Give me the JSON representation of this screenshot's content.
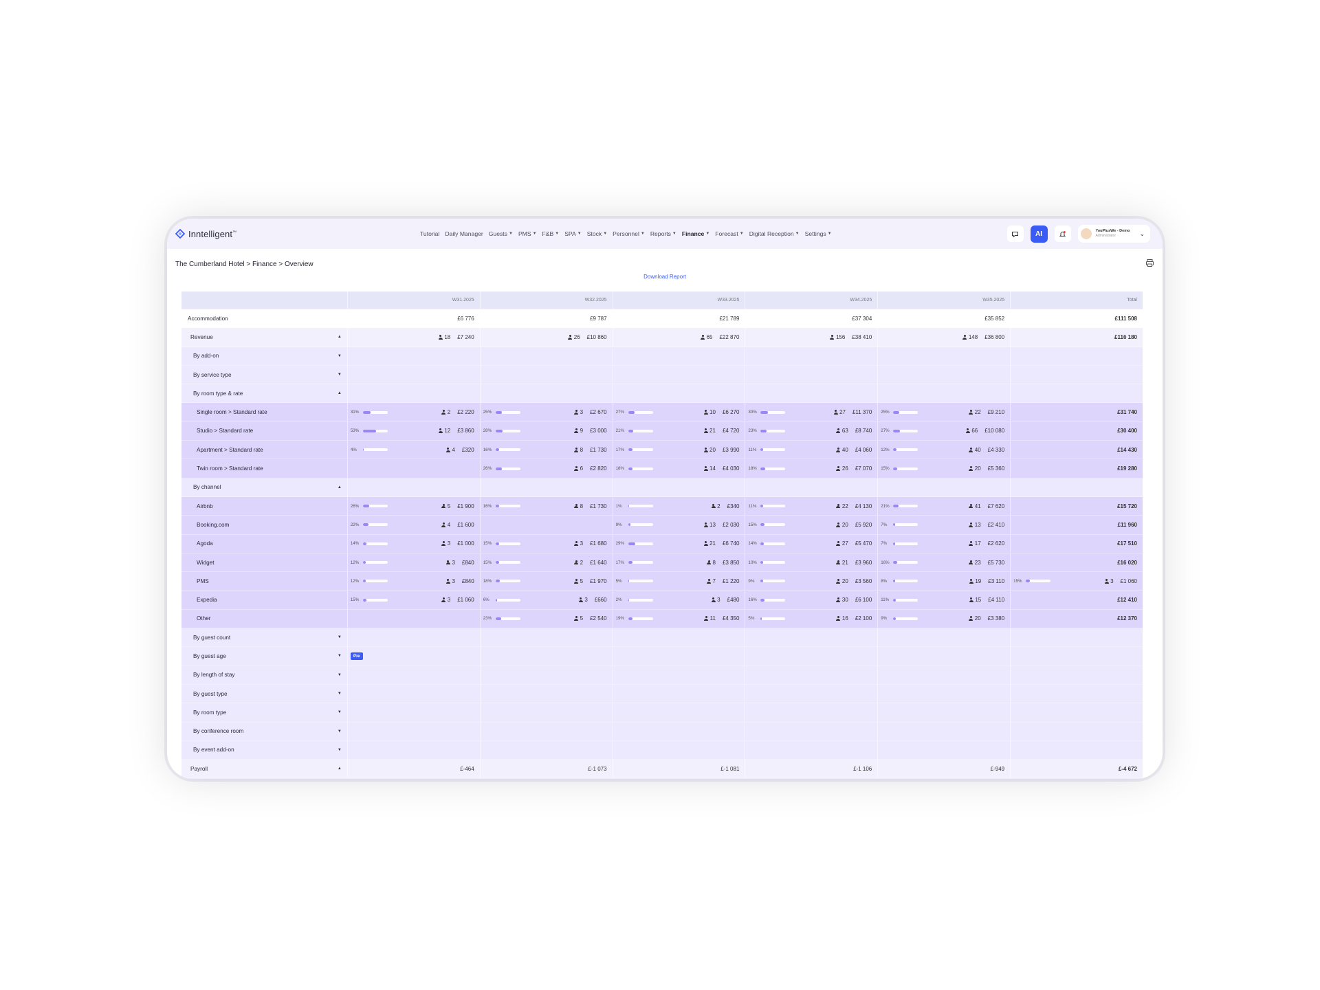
{
  "app": {
    "logo": "Inntelligent",
    "logo_mark": "™"
  },
  "nav": [
    {
      "label": "Tutorial",
      "caret": false,
      "active": false
    },
    {
      "label": "Daily Manager",
      "caret": false,
      "active": false
    },
    {
      "label": "Guests",
      "caret": true,
      "active": false
    },
    {
      "label": "PMS",
      "caret": true,
      "active": false
    },
    {
      "label": "F&B",
      "caret": true,
      "active": false
    },
    {
      "label": "SPA",
      "caret": true,
      "active": false
    },
    {
      "label": "Stock",
      "caret": true,
      "active": false
    },
    {
      "label": "Personnel",
      "caret": true,
      "active": false
    },
    {
      "label": "Reports",
      "caret": true,
      "active": false
    },
    {
      "label": "Finance",
      "caret": true,
      "active": true
    },
    {
      "label": "Forecast",
      "caret": true,
      "active": false
    },
    {
      "label": "Digital Reception",
      "caret": true,
      "active": false
    },
    {
      "label": "Settings",
      "caret": true,
      "active": false
    }
  ],
  "topbar": {
    "ai_label": "AI",
    "user_name": "YouPlusWe - Demo",
    "user_role": "Administrator"
  },
  "breadcrumb": "The Cumberland Hotel > Finance > Overview",
  "download_label": "Download Report",
  "table": {
    "columns": [
      "W31.2025",
      "W32.2025",
      "W33.2025",
      "W34.2025",
      "W35.2025",
      "Total"
    ],
    "rows": [
      {
        "label": "Accommodation",
        "level": "white",
        "cells": [
          {
            "v": "£6 776"
          },
          {
            "v": "£9 787"
          },
          {
            "v": "£21 789"
          },
          {
            "v": "£37 304"
          },
          {
            "v": "£35 852"
          },
          {
            "v": "£111 508",
            "total": true
          }
        ]
      },
      {
        "label": "Revenue",
        "level": "lvl1",
        "toggle": "▲",
        "cells": [
          {
            "g": "18",
            "v": "£7 240"
          },
          {
            "g": "26",
            "v": "£10 860"
          },
          {
            "g": "65",
            "v": "£22 870"
          },
          {
            "g": "156",
            "v": "£38 410"
          },
          {
            "g": "148",
            "v": "£36 800"
          },
          {
            "v": "£116 180",
            "total": true
          }
        ]
      },
      {
        "label": "By add-on",
        "level": "lvl2",
        "toggle": "▼",
        "cells": [
          {},
          {},
          {},
          {},
          {},
          {}
        ]
      },
      {
        "label": "By service type",
        "level": "lvl2",
        "toggle": "▼",
        "cells": [
          {},
          {},
          {},
          {},
          {},
          {}
        ]
      },
      {
        "label": "By room type & rate",
        "level": "lvl2",
        "toggle": "▲",
        "cells": [
          {},
          {},
          {},
          {},
          {},
          {}
        ]
      },
      {
        "label": "Single room > Standard rate",
        "level": "lvl3",
        "cells": [
          {
            "p": "31%",
            "f": 0.31,
            "g": "2",
            "v": "£2 220"
          },
          {
            "p": "25%",
            "f": 0.25,
            "g": "3",
            "v": "£2 670"
          },
          {
            "p": "27%",
            "f": 0.27,
            "g": "10",
            "v": "£6 270"
          },
          {
            "p": "30%",
            "f": 0.3,
            "g": "27",
            "v": "£11 370"
          },
          {
            "p": "25%",
            "f": 0.25,
            "g": "22",
            "v": "£9 210"
          },
          {
            "v": "£31 740",
            "total": true
          }
        ]
      },
      {
        "label": "Studio > Standard rate",
        "level": "lvl3",
        "cells": [
          {
            "p": "53%",
            "f": 0.53,
            "g": "12",
            "v": "£3 860"
          },
          {
            "p": "28%",
            "f": 0.28,
            "g": "9",
            "v": "£3 000"
          },
          {
            "p": "21%",
            "f": 0.21,
            "g": "21",
            "v": "£4 720"
          },
          {
            "p": "23%",
            "f": 0.23,
            "g": "63",
            "v": "£8 740"
          },
          {
            "p": "27%",
            "f": 0.27,
            "g": "66",
            "v": "£10 080"
          },
          {
            "v": "£30 400",
            "total": true
          }
        ]
      },
      {
        "label": "Apartment > Standard rate",
        "level": "lvl3",
        "cells": [
          {
            "p": "4%",
            "f": 0.04,
            "g": "4",
            "v": "£320"
          },
          {
            "p": "16%",
            "f": 0.16,
            "g": "8",
            "v": "£1 730"
          },
          {
            "p": "17%",
            "f": 0.17,
            "g": "20",
            "v": "£3 990"
          },
          {
            "p": "11%",
            "f": 0.11,
            "g": "40",
            "v": "£4 060"
          },
          {
            "p": "12%",
            "f": 0.12,
            "g": "40",
            "v": "£4 330"
          },
          {
            "v": "£14 430",
            "total": true
          }
        ]
      },
      {
        "label": "Twin room > Standard rate",
        "level": "lvl3",
        "cells": [
          {},
          {
            "p": "26%",
            "f": 0.26,
            "g": "6",
            "v": "£2 820"
          },
          {
            "p": "18%",
            "f": 0.18,
            "g": "14",
            "v": "£4 030"
          },
          {
            "p": "18%",
            "f": 0.18,
            "g": "26",
            "v": "£7 070"
          },
          {
            "p": "15%",
            "f": 0.15,
            "g": "20",
            "v": "£5 360"
          },
          {
            "v": "£19 280",
            "total": true
          }
        ]
      },
      {
        "label": "By channel",
        "level": "lvl2",
        "toggle": "▲",
        "cells": [
          {},
          {},
          {},
          {},
          {},
          {}
        ]
      },
      {
        "label": "Airbnb",
        "level": "lvl3",
        "cells": [
          {
            "p": "26%",
            "f": 0.26,
            "g": "5",
            "v": "£1 900"
          },
          {
            "p": "16%",
            "f": 0.16,
            "g": "8",
            "v": "£1 730"
          },
          {
            "p": "1%",
            "f": 0.01,
            "g": "2",
            "v": "£340"
          },
          {
            "p": "11%",
            "f": 0.11,
            "g": "22",
            "v": "£4 130"
          },
          {
            "p": "21%",
            "f": 0.21,
            "g": "41",
            "v": "£7 620"
          },
          {
            "v": "£15 720",
            "total": true
          }
        ]
      },
      {
        "label": "Booking.com",
        "level": "lvl3",
        "cells": [
          {
            "p": "22%",
            "f": 0.22,
            "g": "4",
            "v": "£1 600"
          },
          {},
          {
            "p": "9%",
            "f": 0.09,
            "g": "13",
            "v": "£2 030"
          },
          {
            "p": "15%",
            "f": 0.15,
            "g": "20",
            "v": "£5 920"
          },
          {
            "p": "7%",
            "f": 0.07,
            "g": "13",
            "v": "£2 410"
          },
          {
            "v": "£11 960",
            "total": true
          }
        ]
      },
      {
        "label": "Agoda",
        "level": "lvl3",
        "cells": [
          {
            "p": "14%",
            "f": 0.14,
            "g": "3",
            "v": "£1 000"
          },
          {
            "p": "15%",
            "f": 0.15,
            "g": "3",
            "v": "£1 680"
          },
          {
            "p": "29%",
            "f": 0.29,
            "g": "21",
            "v": "£6 740"
          },
          {
            "p": "14%",
            "f": 0.14,
            "g": "27",
            "v": "£5 470"
          },
          {
            "p": "7%",
            "f": 0.07,
            "g": "17",
            "v": "£2 620"
          },
          {
            "v": "£17 510",
            "total": true
          }
        ]
      },
      {
        "label": "Widget",
        "level": "lvl3",
        "cells": [
          {
            "p": "12%",
            "f": 0.12,
            "g": "3",
            "v": "£840"
          },
          {
            "p": "15%",
            "f": 0.15,
            "g": "2",
            "v": "£1 640"
          },
          {
            "p": "17%",
            "f": 0.17,
            "g": "8",
            "v": "£3 850"
          },
          {
            "p": "10%",
            "f": 0.1,
            "g": "21",
            "v": "£3 960"
          },
          {
            "p": "16%",
            "f": 0.16,
            "g": "23",
            "v": "£5 730"
          },
          {
            "v": "£16 020",
            "total": true
          }
        ]
      },
      {
        "label": "PMS",
        "level": "lvl3",
        "cells": [
          {
            "p": "12%",
            "f": 0.12,
            "g": "3",
            "v": "£840"
          },
          {
            "p": "18%",
            "f": 0.18,
            "g": "5",
            "v": "£1 970"
          },
          {
            "p": "5%",
            "f": 0.05,
            "g": "7",
            "v": "£1 220"
          },
          {
            "p": "9%",
            "f": 0.09,
            "g": "20",
            "v": "£3 560"
          },
          {
            "p": "8%",
            "f": 0.08,
            "g": "19",
            "v": "£3 110"
          },
          {
            "p": "15%",
            "f": 0.15,
            "g": "3",
            "v": "£1 060"
          }
        ]
      },
      {
        "label": "Expedia",
        "level": "lvl3",
        "cells": [
          {
            "p": "15%",
            "f": 0.15,
            "g": "3",
            "v": "£1 060"
          },
          {
            "p": "6%",
            "f": 0.06,
            "g": "3",
            "v": "£660"
          },
          {
            "p": "2%",
            "f": 0.02,
            "g": "3",
            "v": "£480"
          },
          {
            "p": "16%",
            "f": 0.16,
            "g": "30",
            "v": "£6 100"
          },
          {
            "p": "11%",
            "f": 0.11,
            "g": "15",
            "v": "£4 110"
          },
          {
            "v": "£12 410",
            "total": true
          }
        ]
      },
      {
        "label": "Other",
        "level": "lvl3",
        "cells": [
          {},
          {
            "p": "23%",
            "f": 0.23,
            "g": "5",
            "v": "£2 540"
          },
          {
            "p": "19%",
            "f": 0.19,
            "g": "11",
            "v": "£4 350"
          },
          {
            "p": "5%",
            "f": 0.05,
            "g": "16",
            "v": "£2 100"
          },
          {
            "p": "9%",
            "f": 0.09,
            "g": "20",
            "v": "£3 380"
          },
          {
            "v": "£12 370",
            "total": true
          }
        ]
      },
      {
        "label": "By guest count",
        "level": "lvl2",
        "toggle": "▼",
        "cells": [
          {},
          {},
          {},
          {},
          {},
          {}
        ]
      },
      {
        "label": "By guest age",
        "level": "lvl2",
        "toggle": "▼",
        "pie": "Pie",
        "cells": [
          {},
          {},
          {},
          {},
          {},
          {}
        ]
      },
      {
        "label": "By length of stay",
        "level": "lvl2",
        "toggle": "▼",
        "cells": [
          {},
          {},
          {},
          {},
          {},
          {}
        ]
      },
      {
        "label": "By guest type",
        "level": "lvl2",
        "toggle": "▼",
        "cells": [
          {},
          {},
          {},
          {},
          {},
          {}
        ]
      },
      {
        "label": "By room type",
        "level": "lvl2",
        "toggle": "▼",
        "cells": [
          {},
          {},
          {},
          {},
          {},
          {}
        ]
      },
      {
        "label": "By conference room",
        "level": "lvl2",
        "toggle": "▼",
        "cells": [
          {},
          {},
          {},
          {},
          {},
          {}
        ]
      },
      {
        "label": "By event add-on",
        "level": "lvl2",
        "toggle": "▼",
        "cells": [
          {},
          {},
          {},
          {},
          {},
          {}
        ]
      },
      {
        "label": "Payroll",
        "level": "lvl1",
        "toggle": "▲",
        "cells": [
          {
            "v": "£-464"
          },
          {
            "v": "£-1 073"
          },
          {
            "v": "£-1 081"
          },
          {
            "v": "£-1 106"
          },
          {
            "v": "£-949"
          },
          {
            "v": "£-4 672",
            "total": true
          }
        ]
      }
    ]
  }
}
